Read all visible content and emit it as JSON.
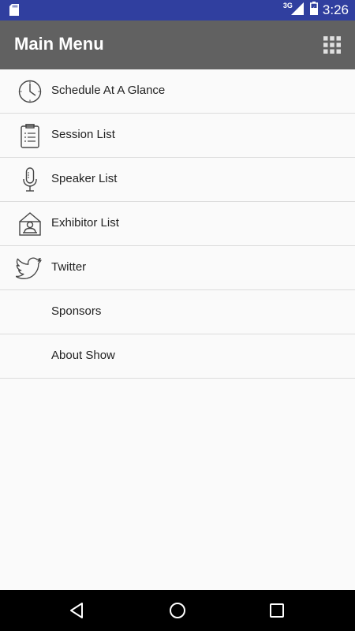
{
  "status_bar": {
    "network": "3G",
    "time": "3:26",
    "icons": [
      "sd-card-icon",
      "signal-icon",
      "battery-icon"
    ]
  },
  "app_bar": {
    "title": "Main Menu",
    "action_icon": "grid-icon"
  },
  "menu": [
    {
      "label": "Schedule At A Glance",
      "icon": "clock-icon"
    },
    {
      "label": "Session List",
      "icon": "clipboard-icon"
    },
    {
      "label": "Speaker List",
      "icon": "microphone-icon"
    },
    {
      "label": "Exhibitor List",
      "icon": "exhibitor-booth-icon"
    },
    {
      "label": "Twitter",
      "icon": "twitter-bird-icon"
    },
    {
      "label": "Sponsors",
      "icon": ""
    },
    {
      "label": "About Show",
      "icon": ""
    }
  ],
  "nav_bar": {
    "icons": [
      "back-icon",
      "home-icon",
      "recents-icon"
    ]
  },
  "colors": {
    "status_bar": "#303f9f",
    "app_bar": "#616161",
    "background": "#fafafa",
    "divider": "#dcdcdc"
  }
}
